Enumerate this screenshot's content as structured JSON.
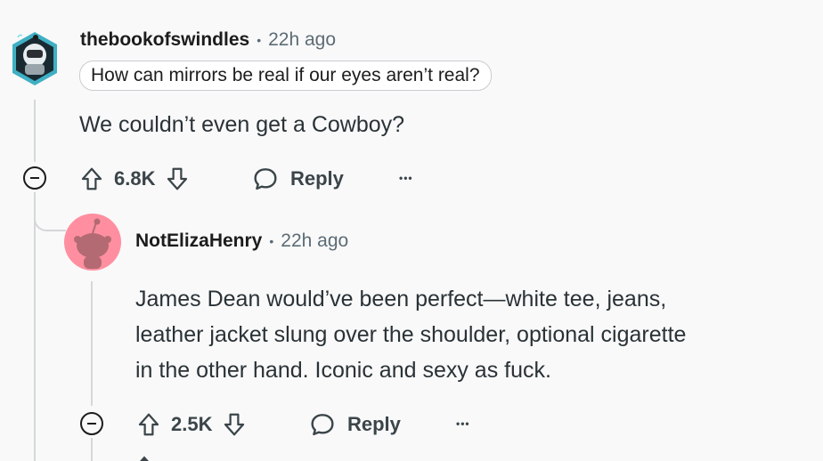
{
  "comments": [
    {
      "username": "thebookofswindles",
      "separator": "•",
      "time": "22h ago",
      "flair": "How can mirrors be real if our eyes aren’t real?",
      "body": "We couldn’t even get a Cowboy?",
      "score": "6.8K",
      "reply_label": "Reply",
      "more_label": "•••"
    },
    {
      "username": "NotElizaHenry",
      "separator": "•",
      "time": "22h ago",
      "body_lines": [
        "James Dean would’ve been perfect—white tee, jeans,",
        "leather jacket slung over the shoulder, optional cigarette",
        "in the other hand. Iconic and sexy as fuck."
      ],
      "score": "2.5K",
      "reply_label": "Reply",
      "more_label": "•••"
    }
  ],
  "colors": {
    "background": "#f9f9fa",
    "avatar2_bg": "#ff8fa0",
    "text_secondary": "#5c6c74"
  }
}
